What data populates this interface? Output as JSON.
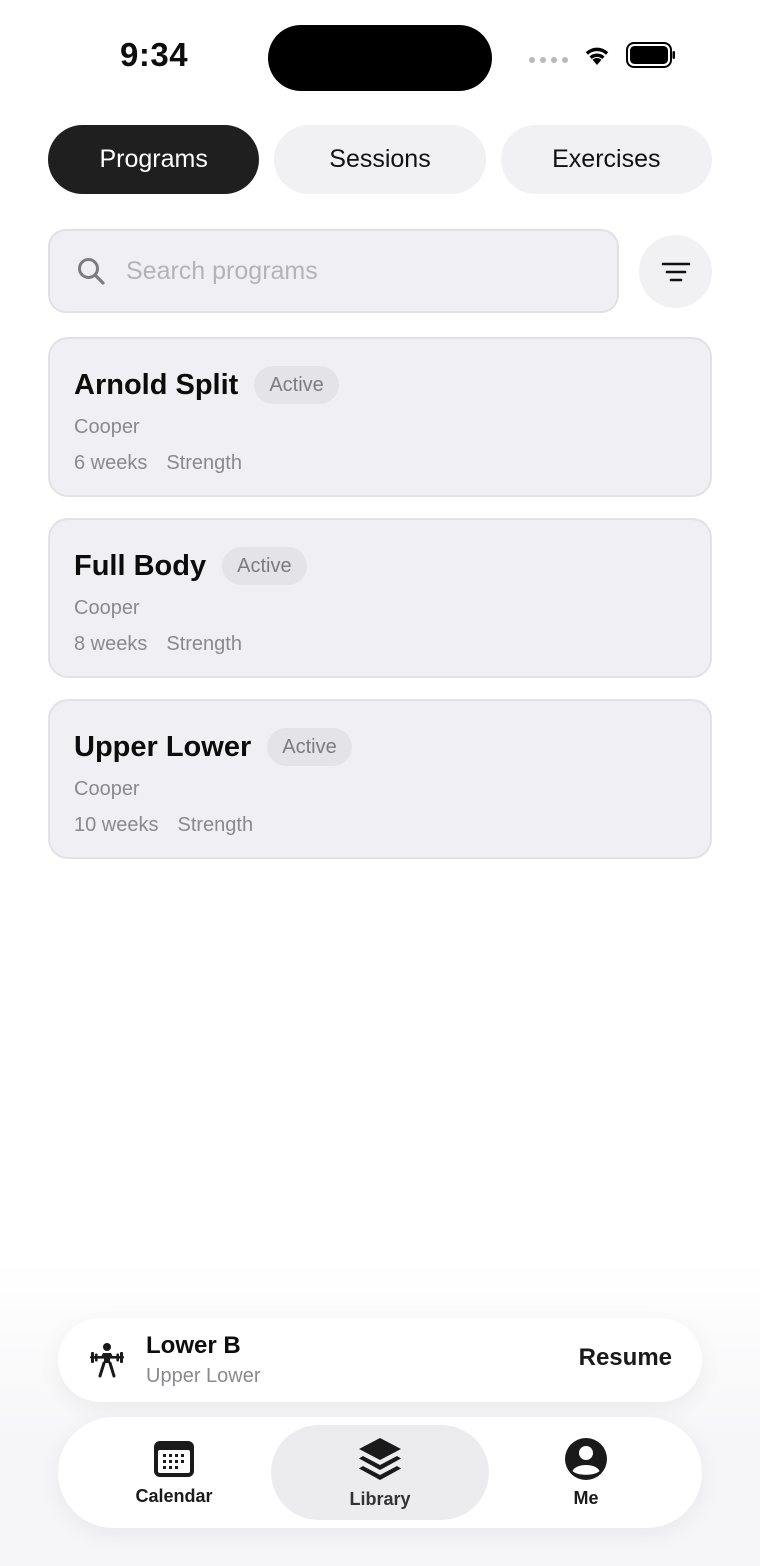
{
  "status_bar": {
    "time": "9:34"
  },
  "tabs": [
    {
      "label": "Programs",
      "active": true
    },
    {
      "label": "Sessions",
      "active": false
    },
    {
      "label": "Exercises",
      "active": false
    }
  ],
  "search": {
    "placeholder": "Search programs",
    "value": ""
  },
  "programs": [
    {
      "title": "Arnold Split",
      "status": "Active",
      "author": "Cooper",
      "duration": "6 weeks",
      "category": "Strength"
    },
    {
      "title": "Full Body",
      "status": "Active",
      "author": "Cooper",
      "duration": "8 weeks",
      "category": "Strength"
    },
    {
      "title": "Upper Lower",
      "status": "Active",
      "author": "Cooper",
      "duration": "10 weeks",
      "category": "Strength"
    }
  ],
  "now_playing": {
    "icon": "weightlifter-icon",
    "title": "Lower B",
    "subtitle": "Upper Lower",
    "action": "Resume"
  },
  "nav": [
    {
      "label": "Calendar",
      "icon": "calendar-icon",
      "active": false
    },
    {
      "label": "Library",
      "icon": "layers-icon",
      "active": true
    },
    {
      "label": "Me",
      "icon": "person-icon",
      "active": false
    }
  ],
  "colors": {
    "active_tab_bg": "#1f1f1f",
    "card_bg": "#f0f0f4",
    "muted_text": "#8a8a8e",
    "badge_bg": "#e4e4e8"
  }
}
